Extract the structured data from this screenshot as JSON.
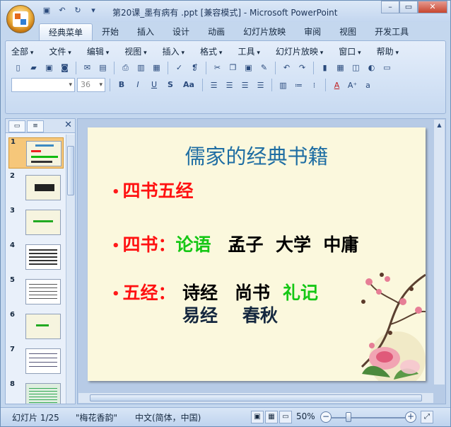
{
  "window": {
    "title": "第20课_墨有病有 .ppt [兼容模式] - Microsoft PowerPoint",
    "quick_access": [
      "save-icon",
      "undo-icon",
      "redo-icon",
      "customize-icon"
    ],
    "controls": {
      "minimize": "–",
      "restore": "▭",
      "close": "✕"
    }
  },
  "tabs": [
    "经典菜单",
    "开始",
    "插入",
    "设计",
    "动画",
    "幻灯片放映",
    "审阅",
    "视图",
    "开发工具"
  ],
  "menu": [
    "全部",
    "文件",
    "编辑",
    "视图",
    "插入",
    "格式",
    "工具",
    "幻灯片放映",
    "窗口",
    "帮助"
  ],
  "font": {
    "family": "",
    "size": "36"
  },
  "slides_pane": {
    "tab_slides": "▭",
    "tab_outline": "≡",
    "close": "✕",
    "numbers": [
      "1",
      "2",
      "3",
      "4",
      "5",
      "6",
      "7",
      "8"
    ]
  },
  "slide": {
    "title": "儒家的经典书籍",
    "bullet1": "四书五经",
    "bullet2_head": "四书：",
    "bullet2_green": "论语",
    "bullet2_rest": "孟子  大学  中庸",
    "bullet3_head": "五经：",
    "bullet3_l1a": "诗经",
    "bullet3_l1b": "尚书",
    "bullet3_l1c": "礼记",
    "bullet3_l2": "易经    春秋"
  },
  "status": {
    "slide_count": "幻灯片 1/25",
    "theme": "\"梅花香韵\"",
    "language": "中文(简体，中国)",
    "zoom": "50%"
  }
}
